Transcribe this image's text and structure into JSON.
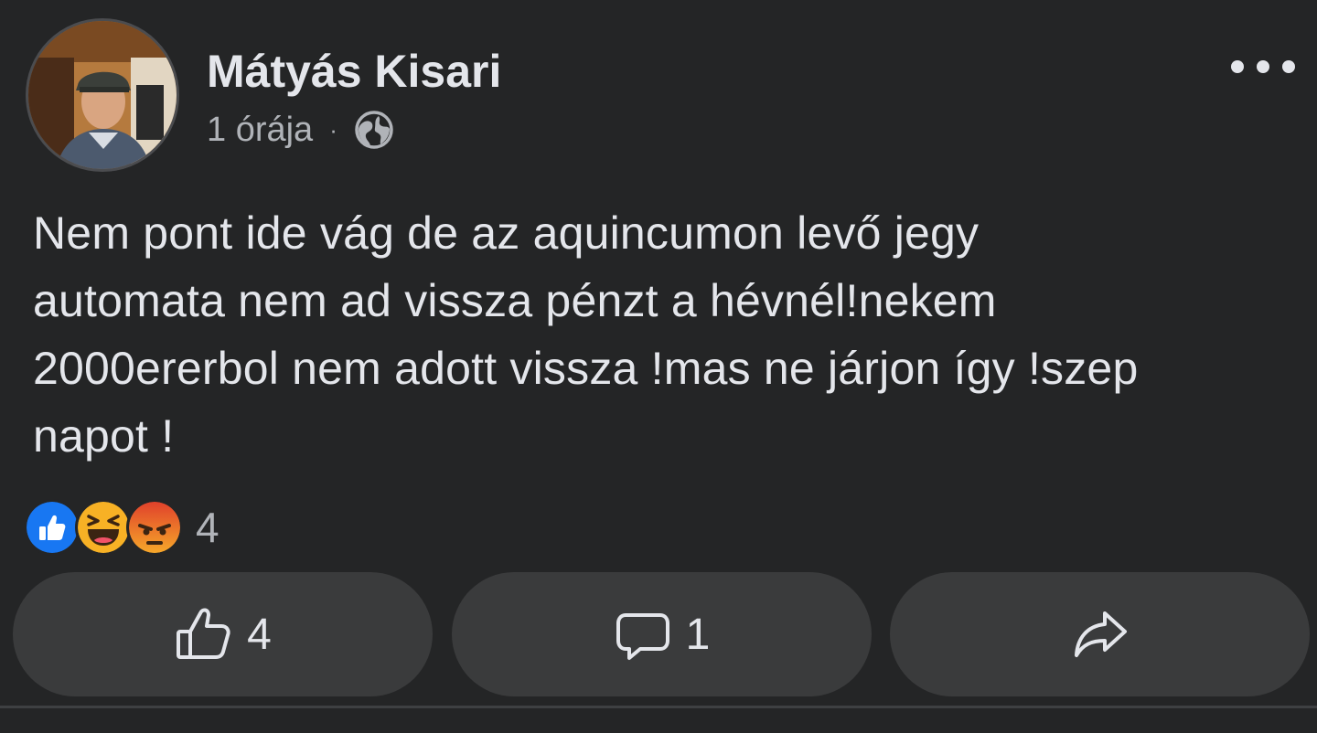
{
  "post": {
    "author": "Mátyás Kisari",
    "time": "1 órája",
    "separator": "·",
    "privacy_icon": "globe-icon",
    "more_icon": "more-options-icon",
    "body": "Nem pont ide vág de az aquincumon levő jegy\nautomata nem ad vissza pénzt a hévnél!nekem\n2000ererbol nem adott vissza !mas ne járjon így !szep\nnapot !",
    "reactions": {
      "types": [
        "like",
        "haha",
        "angry"
      ],
      "count": "4"
    },
    "actions": {
      "like_count": "4",
      "comment_count": "1",
      "share_icon": "share-icon"
    }
  },
  "colors": {
    "background": "#242526",
    "button_background": "#3a3b3c",
    "text_primary": "#e4e6eb",
    "text_secondary": "#b0b3b8",
    "like_blue": "#1877f2",
    "haha_yellow": "#f7b125",
    "angry_orange": "#e9710f"
  }
}
